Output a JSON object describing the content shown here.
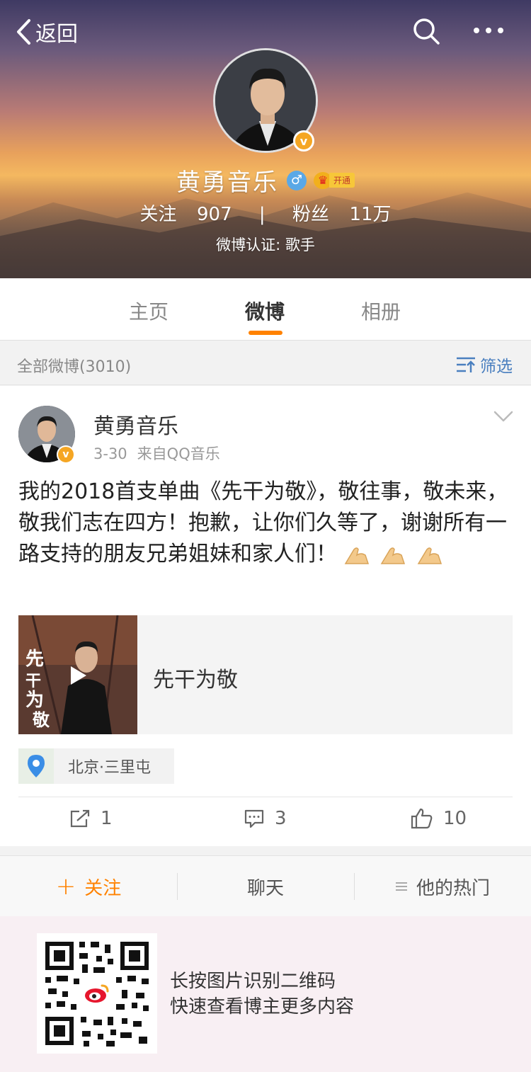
{
  "header": {
    "back_label": "返回",
    "profile_name": "黄勇音乐",
    "vip_open_label": "开通",
    "following_label": "关注",
    "following_count": "907",
    "separator": "|",
    "followers_label": "粉丝",
    "followers_count": "11万",
    "verification": "微博认证: 歌手"
  },
  "tabs": [
    {
      "label": "主页",
      "active": false
    },
    {
      "label": "微博",
      "active": true
    },
    {
      "label": "相册",
      "active": false
    }
  ],
  "filter": {
    "count_label": "全部微博(3010)",
    "filter_label": "筛选"
  },
  "post": {
    "author": "黄勇音乐",
    "date": "3-30",
    "source": "来自QQ音乐",
    "text": "我的2018首支单曲《先干为敬》，敬往事，敬未来，敬我们志在四方！抱歉，让你们久等了，谢谢所有一路支持的朋友兄弟姐妹和家人们！",
    "media_title": "先干为敬",
    "location": "北京·三里屯",
    "reposts": "1",
    "comments": "3",
    "likes": "10"
  },
  "bottom_bar": {
    "follow_label": "关注",
    "chat_label": "聊天",
    "hot_label": "他的热门"
  },
  "qr": {
    "line1": "长按图片识别二维码",
    "line2": "快速查看博主更多内容"
  },
  "colors": {
    "accent": "#ff8200",
    "link_blue": "#4a7fbf",
    "verified_badge": "#f5a623",
    "male_badge": "#5aa8e6"
  },
  "icons": [
    "back-chevron-icon",
    "search-icon",
    "more-dots-icon",
    "verified-icon",
    "male-icon",
    "vip-crown-icon",
    "filter-icon",
    "chevron-down-icon",
    "play-icon",
    "location-pin-icon",
    "repost-icon",
    "comment-icon",
    "like-icon",
    "plus-icon",
    "menu-lines-icon",
    "weibo-logo-icon"
  ]
}
